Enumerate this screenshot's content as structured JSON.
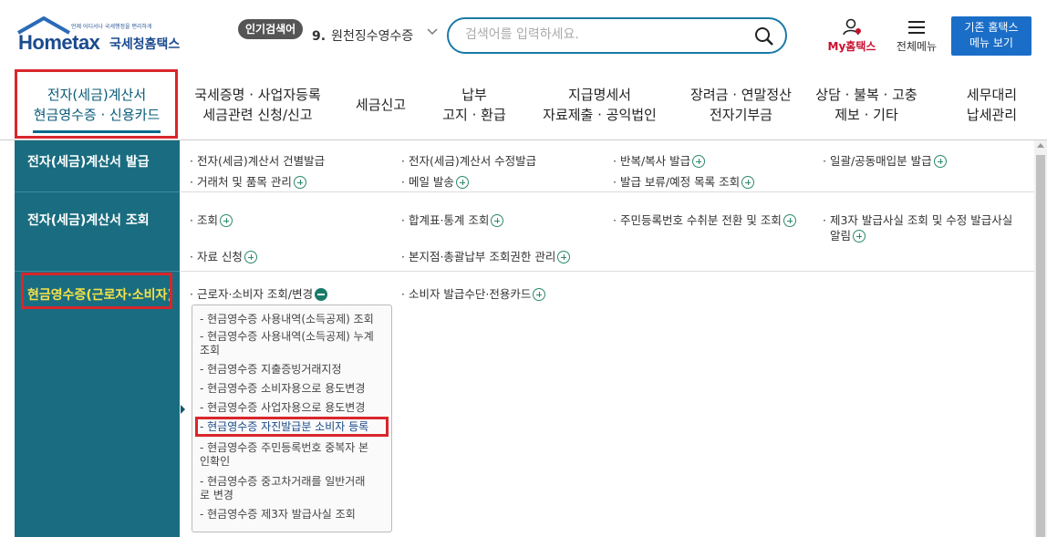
{
  "header": {
    "logo_tagline": "언제 어디서나 국세행정을 편리하게",
    "logo_main": "Hometax",
    "logo_sub": "국세청홈택스",
    "popular_badge": "인기검색어",
    "popular_num": "9.",
    "popular_text": "원천징수영수증",
    "search_placeholder": "검색어를 입력하세요.",
    "my_hometax": "My홈택스",
    "all_menu": "전체메뉴",
    "old_menu_line1": "기존 홈택스",
    "old_menu_line2": "메뉴 보기"
  },
  "gnb": [
    {
      "label": "전자(세금)계산서\n현금영수증 · 신용카드"
    },
    {
      "label": "국세증명 · 사업자등록\n세금관련 신청/신고"
    },
    {
      "label": "세금신고"
    },
    {
      "label": "납부\n고지 · 환급"
    },
    {
      "label": "지급명세서\n자료제출 · 공익법인"
    },
    {
      "label": "장려금 · 연말정산\n전자기부금"
    },
    {
      "label": "상담 · 불복 · 고충\n제보 · 기타"
    },
    {
      "label": "세무대리\n납세관리"
    }
  ],
  "categories": [
    {
      "label": "전자(세금)계산서 발급"
    },
    {
      "label": "전자(세금)계산서 조회"
    },
    {
      "label": "현금영수증(근로자·소비자)"
    }
  ],
  "links": {
    "issue_direct": "· 전자(세금)계산서 건별발급",
    "issue_modify": "· 전자(세금)계산서 수정발급",
    "issue_repeat": "· 반복/복사 발급",
    "issue_bulk": "· 일괄/공동매입분 발급",
    "partner_items": "· 거래처 및 품목 관리",
    "mail_send": "· 메일 발송",
    "issue_hold": "· 발급 보류/예정 목록 조회",
    "inquiry": "· 조회",
    "summary_stats": "· 합계표·통계 조회",
    "rrn_convert": "· 주민등록번호 수취분 전환 및 조회",
    "third_party": "· 제3자 발급사실 조회 및 수정 발급사실",
    "third_party_2": "알림",
    "data_request": "· 자료 신청",
    "branch_auth": "· 본지점·총괄납부 조회권한 관리",
    "consumer_inquiry": "· 근로자·소비자 조회/변경",
    "consumer_card": "· 소비자 발급수단·전용카드"
  },
  "submenu": [
    "- 현금영수증 사용내역(소득공제) 조회",
    "- 현금영수증 사용내역(소득공제) 누계\n  조회",
    "- 현금영수증 지출증빙거래지정",
    "- 현금영수증 소비자용으로 용도변경",
    "- 현금영수증 사업자용으로 용도변경",
    "- 현금영수증 자진발급분 소비자 등록",
    "- 현금영수증 주민등록번호 중복자 본\n  인확인",
    "- 현금영수증 중고차거래를 일반거래\n  로 변경",
    "- 현금영수증 제3자 발급사실 조회"
  ],
  "colors": {
    "accent": "#1a6d80",
    "highlight": "#d9262c",
    "button": "#1a6ec8"
  }
}
